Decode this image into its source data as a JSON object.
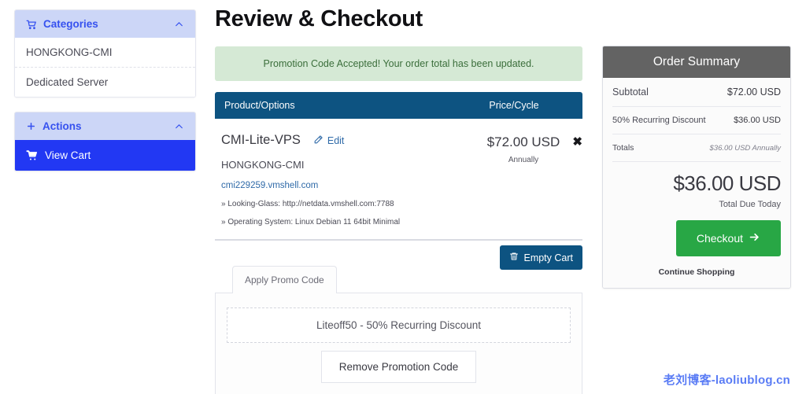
{
  "sidebar": {
    "categories": {
      "title": "Categories",
      "icon": "shopping-cart-icon",
      "collapse_icon": "chevron-up-icon",
      "items": [
        {
          "label": "HONGKONG-CMI"
        },
        {
          "label": "Dedicated Server"
        }
      ]
    },
    "actions": {
      "title": "Actions",
      "icon": "plus-icon",
      "collapse_icon": "chevron-up-icon",
      "items": [
        {
          "label": "View Cart",
          "icon": "shopping-cart-icon",
          "active": true
        }
      ]
    }
  },
  "main": {
    "page_title": "Review & Checkout",
    "alert": {
      "message": "Promotion Code Accepted! Your order total has been updated.",
      "bg_color": "#d5e9d5",
      "text_color": "#3b6e3b"
    },
    "cart_header": {
      "product_col": "Product/Options",
      "price_col": "Price/Cycle",
      "bg_color": "#0d5381"
    },
    "cart_item": {
      "name": "CMI-Lite-VPS",
      "edit_label": "Edit",
      "edit_icon": "pencil-icon",
      "group": "HONGKONG-CMI",
      "domain": "cmi229259.vmshell.com",
      "options": [
        "» Looking-Glass: http://netdata.vmshell.com:7788",
        "» Operating System: Linux Debian 11 64bit Minimal"
      ],
      "price": "$72.00 USD",
      "cycle": "Annually",
      "remove_icon": "close-x-icon"
    },
    "empty_cart": {
      "label": "Empty Cart",
      "icon": "trash-icon"
    },
    "promo": {
      "tab_label": "Apply Promo Code",
      "applied_code": "Liteoff50 - 50% Recurring Discount",
      "remove_label": "Remove Promotion Code"
    }
  },
  "summary": {
    "title": "Order Summary",
    "header_bg": "#636363",
    "rows": [
      {
        "label": "Subtotal",
        "value": "$72.00 USD"
      },
      {
        "label": "50% Recurring Discount",
        "value": "$36.00 USD"
      },
      {
        "label": "Totals",
        "value": "$36.00 USD Annually"
      }
    ],
    "grand_total": "$36.00 USD",
    "grand_total_caption": "Total Due Today",
    "checkout_label": "Checkout",
    "checkout_icon": "arrow-right-icon",
    "checkout_color": "#28a745",
    "continue_label": "Continue Shopping"
  },
  "watermark": {
    "text": "老刘博客-laoliublog.cn",
    "color": "#5a7cf5"
  }
}
